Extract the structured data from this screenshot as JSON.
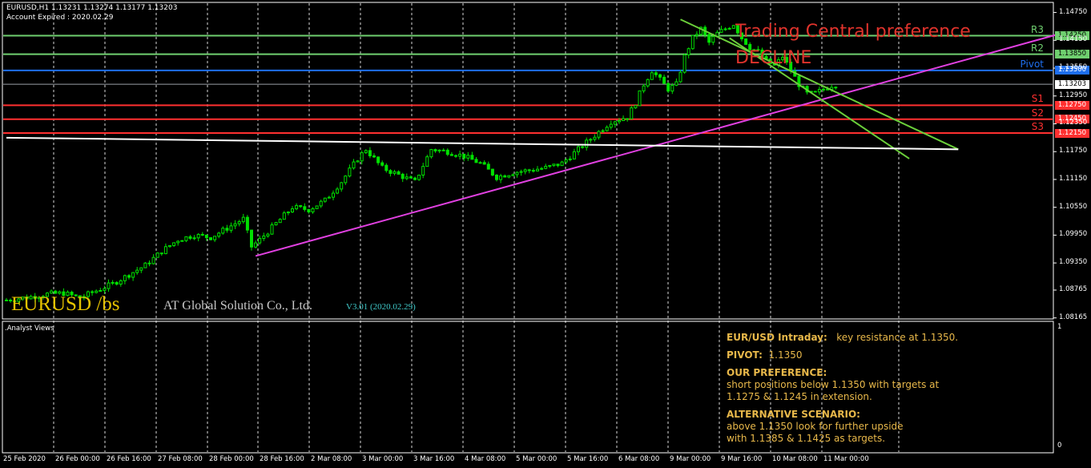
{
  "header": {
    "symbol_line": "EURUSD,H1  1.13231 1.13274 1.13177 1.13203",
    "account_line": "Account Expired : 2020.02.29"
  },
  "branding": {
    "symbol_big": "EURUSD /bs",
    "company": "AT Global Solution Co., Ltd.",
    "version": "V3.01 (2020.02.29)"
  },
  "preference": {
    "line1": "Trading Central preference",
    "line2": "DECLINE"
  },
  "colors": {
    "background": "#000000",
    "grid": "#ffffff",
    "candle": "#00e000",
    "resistance": "#6fcf6f",
    "pivot": "#1e6ff0",
    "support": "#ff3030",
    "trendline": "#e040e0",
    "channel": "#6bcf3a",
    "support_base": "#ffffff",
    "analyst_text": "#e8b84a",
    "preference_text": "#e0332c"
  },
  "chart_data": {
    "type": "candlestick",
    "symbol": "EURUSD",
    "timeframe": "H1",
    "ylim": [
      1.0816,
      1.1495
    ],
    "y_ticks": [
      "1.14750",
      "1.14150",
      "1.13550",
      "1.12950",
      "1.12350",
      "1.11750",
      "1.11150",
      "1.10550",
      "1.09950",
      "1.09350",
      "1.08765",
      "1.08165"
    ],
    "x_labels": [
      "25 Feb 2020",
      "26 Feb 00:00",
      "26 Feb 16:00",
      "27 Feb 08:00",
      "28 Feb 00:00",
      "28 Feb 16:00",
      "2 Mar 08:00",
      "3 Mar 00:00",
      "3 Mar 16:00",
      "4 Mar 08:00",
      "5 Mar 00:00",
      "5 Mar 16:00",
      "6 Mar 08:00",
      "9 Mar 00:00",
      "9 Mar 16:00",
      "10 Mar 08:00",
      "11 Mar 00:00"
    ],
    "levels": [
      {
        "name": "R3",
        "value": 1.1425,
        "label": "1.14250",
        "kind": "resistance"
      },
      {
        "name": "R2",
        "value": 1.1385,
        "label": "1.13850",
        "kind": "resistance"
      },
      {
        "name": "Pivot",
        "value": 1.135,
        "label": "1.13500",
        "kind": "pivot"
      },
      {
        "name": "S1",
        "value": 1.1275,
        "label": "1.12750",
        "kind": "support"
      },
      {
        "name": "S2",
        "value": 1.1245,
        "label": "1.12450",
        "kind": "support"
      },
      {
        "name": "S3",
        "value": 1.1215,
        "label": "1.12150",
        "kind": "support"
      }
    ],
    "current_price": {
      "value": 1.13203,
      "label": "1.13203"
    },
    "close_path": [
      [
        0,
        1.0855
      ],
      [
        6,
        1.0862
      ],
      [
        10,
        1.0868
      ],
      [
        14,
        1.087
      ],
      [
        18,
        1.086
      ],
      [
        22,
        1.0875
      ],
      [
        26,
        1.089
      ],
      [
        30,
        1.091
      ],
      [
        34,
        1.093
      ],
      [
        38,
        1.096
      ],
      [
        42,
        1.0985
      ],
      [
        46,
        1.0995
      ],
      [
        50,
        1.099
      ],
      [
        54,
        1.101
      ],
      [
        58,
        1.103
      ],
      [
        60,
        1.097
      ],
      [
        62,
        1.0985
      ],
      [
        66,
        1.102
      ],
      [
        70,
        1.1055
      ],
      [
        74,
        1.105
      ],
      [
        78,
        1.107
      ],
      [
        82,
        1.111
      ],
      [
        86,
        1.116
      ],
      [
        88,
        1.118
      ],
      [
        92,
        1.114
      ],
      [
        96,
        1.1125
      ],
      [
        100,
        1.111
      ],
      [
        104,
        1.118
      ],
      [
        108,
        1.1175
      ],
      [
        112,
        1.1165
      ],
      [
        116,
        1.115
      ],
      [
        120,
        1.112
      ],
      [
        124,
        1.113
      ],
      [
        128,
        1.1135
      ],
      [
        132,
        1.114
      ],
      [
        136,
        1.115
      ],
      [
        140,
        1.118
      ],
      [
        144,
        1.121
      ],
      [
        148,
        1.124
      ],
      [
        152,
        1.125
      ],
      [
        154,
        1.128
      ],
      [
        156,
        1.132
      ],
      [
        158,
        1.135
      ],
      [
        160,
        1.133
      ],
      [
        162,
        1.131
      ],
      [
        164,
        1.132
      ],
      [
        166,
        1.138
      ],
      [
        168,
        1.142
      ],
      [
        170,
        1.144
      ],
      [
        172,
        1.141
      ],
      [
        174,
        1.143
      ],
      [
        176,
        1.144
      ],
      [
        178,
        1.145
      ],
      [
        180,
        1.142
      ],
      [
        182,
        1.14
      ],
      [
        184,
        1.139
      ],
      [
        186,
        1.137
      ],
      [
        188,
        1.136
      ],
      [
        190,
        1.138
      ],
      [
        192,
        1.135
      ],
      [
        194,
        1.132
      ],
      [
        196,
        1.13
      ],
      [
        198,
        1.13
      ],
      [
        200,
        1.131
      ],
      [
        202,
        1.1318
      ],
      [
        203,
        1.132
      ]
    ],
    "trendlines": [
      {
        "name": "ascending",
        "from": {
          "bar": 61,
          "price": 1.095
        },
        "to": {
          "bar": 257,
          "price": 1.1427
        },
        "color": "#e040e0"
      },
      {
        "name": "channel-upper",
        "from": {
          "bar": 165,
          "price": 1.146
        },
        "to": {
          "bar": 233,
          "price": 1.118
        },
        "color": "#6bcf3a"
      },
      {
        "name": "channel-lower",
        "from": {
          "bar": 177,
          "price": 1.142
        },
        "to": {
          "bar": 221,
          "price": 1.116
        },
        "color": "#6bcf3a"
      },
      {
        "name": "support-base",
        "from": {
          "bar": 0,
          "price": 1.1205
        },
        "to": {
          "bar": 233,
          "price": 1.118
        },
        "color": "#ffffff"
      }
    ]
  },
  "subwindow": {
    "label": ".Analyst Views",
    "scale_top": "1",
    "scale_bottom": "0"
  },
  "analyst": {
    "title_label": "EUR/USD Intraday:",
    "title_value": "key resistance at 1.1350.",
    "pivot_label": "PIVOT:",
    "pivot_value": "1.1350",
    "pref_heading": "OUR PREFERENCE:",
    "pref_line1": "short positions below 1.1350 with targets at",
    "pref_line2": "1.1275 & 1.1245 in extension.",
    "alt_heading": "ALTERNATIVE SCENARIO:",
    "alt_line1": "above 1.1350 look for further upside",
    "alt_line2": "with 1.1385 & 1.1425 as targets."
  }
}
